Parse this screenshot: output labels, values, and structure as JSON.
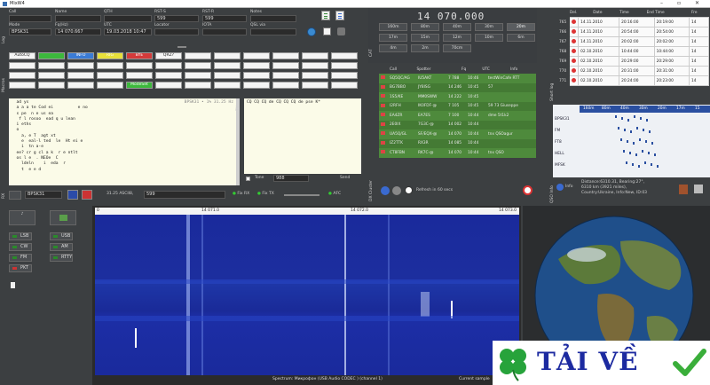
{
  "window": {
    "title": "MixW4",
    "controls": [
      "–",
      "▫",
      "✕"
    ]
  },
  "qso": {
    "labels": {
      "call": "Call",
      "name": "Name",
      "qth": "QTH",
      "rst_s": "RST-S",
      "rst_r": "RST-R",
      "notes": "Notes",
      "mode": "Mode",
      "freq": "Fq(Hz)",
      "utc": "UTC",
      "locator": "Locator",
      "iota": "IOTA",
      "qsl_via": "QSL via"
    },
    "values": {
      "call": "",
      "name": "",
      "qth": "",
      "rst_s": "599",
      "rst_r": "599",
      "notes": "",
      "mode": "BPSK31",
      "freq": "14 070.667",
      "utc": "19.03.2018 10:47",
      "locator": "",
      "iota": "",
      "qsl_via": ""
    },
    "side_label": "Log"
  },
  "macros": {
    "row1": [
      "AutoCQ",
      "",
      "INFO",
      "RIG",
      "BYE",
      "QRZ?",
      "",
      "",
      "",
      "",
      "",
      ""
    ],
    "row1_colors": [
      "#f4f4f4",
      "#3cb83c",
      "#3a7bd5",
      "#e8e03a",
      "#d43a3a",
      "#f4f4f4",
      "#f4f4f4",
      "#f4f4f4",
      "#f4f4f4",
      "#f4f4f4",
      "#f4f4f4",
      "#f4f4f4"
    ],
    "mode_set": "ModeSet",
    "side_label": "Macros"
  },
  "rx": {
    "header": "BPSK31 • 1% 31.25 Hz",
    "lines": [
      "",
      "  ad ys",
      "  a a a te Cod ei          e no",
      "  s pe  n e us ea",
      "   f l rosoo  ead q u lean",
      "  i eths",
      "  o",
      "    a, e T  agt xt",
      "    e  eal-l ted  le  Ht ei e",
      "    i  tn a-e",
      "  ee? cr g cl a k  r e ntlt",
      "",
      "  os l e  . NEOe  C",
      "    ldeln    i  eda  r",
      "    t  e e d"
    ],
    "status": "31.25  ASCII8,",
    "status_field": "599",
    "mode_field": "BPSK31"
  },
  "tx": {
    "text": "CQ CQ CQ de CQ CQ CQ de pse K*",
    "side_label": "TX",
    "tone_label": "Tone",
    "tone_value": "988",
    "send_label": "Send",
    "fix_rx": "Fix RX",
    "fix_tx": "Fix TX",
    "afc": "AFC"
  },
  "cat": {
    "freq": "14 070.000",
    "bands": [
      "160m",
      "80m",
      "40m",
      "30m",
      "20m",
      "17m",
      "15m",
      "12m",
      "10m",
      "6m",
      "4m",
      "2m",
      "70cm"
    ],
    "active_band": "20m",
    "side_label": "CAT"
  },
  "cluster": {
    "headers": [
      "Call",
      "Spotter",
      "Fq",
      "UTC",
      "Info"
    ],
    "rows": [
      [
        "SQ5QC/AG",
        "IU5AKT",
        "7 788",
        "10:46",
        "testWinCafe RTT"
      ],
      [
        "BG7BBO",
        "JY8ISG",
        "14 246",
        "10:45",
        "57"
      ],
      [
        "1S5/KE",
        "MM0SWW",
        "14 222",
        "10:45",
        ""
      ],
      [
        "I2RFH",
        "IK0FDF-@",
        "7 105",
        "10:45",
        "59 73 Giuseppe"
      ],
      [
        "EA4ZR",
        "EA7ES",
        "7 100",
        "10:44",
        "dme 5t1k2"
      ],
      [
        "2E0IX",
        "7G3C-@",
        "14 002",
        "10:44",
        ""
      ],
      [
        "UA5Q/GL",
        "SF/EQX-@",
        "14 070",
        "10:44",
        "tnx QSOagur"
      ],
      [
        "IZ2TTK",
        "RX3R",
        "14 085",
        "10:44",
        ""
      ],
      [
        "CT8FBN",
        "RK7C-@",
        "14 070",
        "10:44",
        "tnx QSO"
      ]
    ],
    "refresh": "Refresh in 60 secs",
    "side_label": "DX Cluster"
  },
  "shortlog": {
    "headers": [
      "Del.",
      "Date",
      "Time",
      "End Time",
      "Fre"
    ],
    "rows": [
      [
        "765",
        "14.11.2010",
        "20:16:00",
        "20:19:00",
        "14"
      ],
      [
        "766",
        "14.11.2010",
        "20:54:00",
        "20:54:00",
        "14"
      ],
      [
        "767",
        "14.11.2010",
        "20:02:00",
        "20:02:00",
        "14"
      ],
      [
        "768",
        "02.10.2010",
        "10:44:00",
        "10:44:00",
        "14"
      ],
      [
        "769",
        "02.10.2010",
        "20:29:00",
        "20:29:00",
        "14"
      ],
      [
        "770",
        "02.10.2010",
        "20:31:00",
        "20:31:00",
        "14"
      ],
      [
        "771",
        "02.10.2010",
        "20:24:00",
        "20:23:00",
        "14"
      ]
    ],
    "side_label": "Short log"
  },
  "bandmap": {
    "bands": [
      "160m",
      "80m",
      "40m",
      "30m",
      "20m",
      "17m",
      "15"
    ],
    "modes": [
      "BPSK31",
      "FM",
      "FT8",
      "HELL",
      "MFSK"
    ]
  },
  "qso_info": {
    "info_label": "Info",
    "distance": "Distance:6310.31, Bearing:27°,",
    "miles": "6310 km (3921 miles),",
    "country": "Country:Ukraine, Info:New, ID:03",
    "side_label": "QSO Info"
  },
  "modes_panel": {
    "modes": [
      {
        "label": "LSB",
        "active": false
      },
      {
        "label": "USB",
        "active": false
      },
      {
        "label": "CW",
        "active": false
      },
      {
        "label": "AM",
        "active": false
      },
      {
        "label": "FM",
        "active": false
      },
      {
        "label": "RTTY",
        "active": false
      },
      {
        "label": "PKT",
        "active": true
      }
    ]
  },
  "waterfall": {
    "scale": [
      "0",
      "14 071.0",
      "14 072.0",
      "14 073.0"
    ],
    "status": "Spectrum: Микрофон (USB Audio CODEC ) (channel 1)",
    "status_right": "Current sample"
  },
  "watermark": {
    "text": "TẢI VỀ"
  }
}
